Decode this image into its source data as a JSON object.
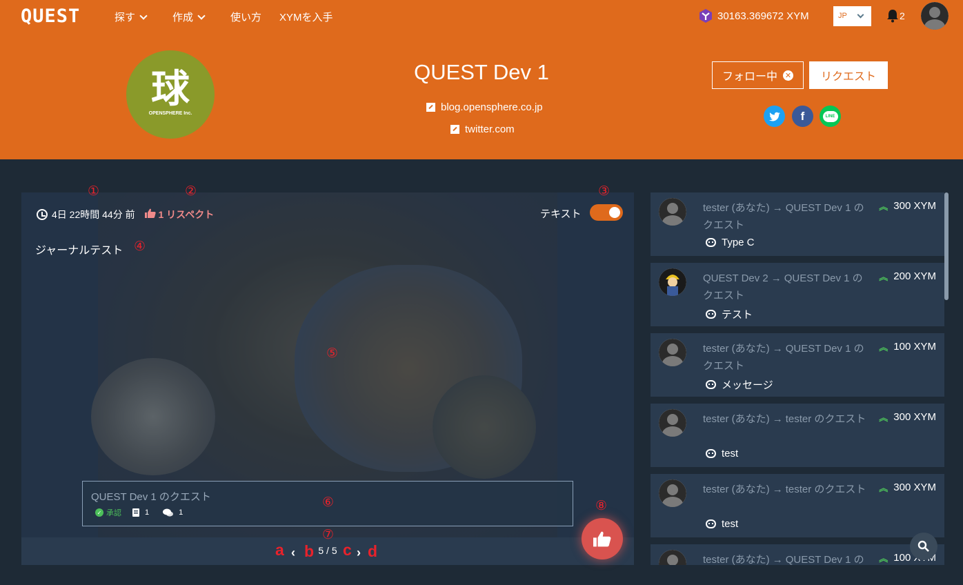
{
  "nav": {
    "logo": "QUEST",
    "items": [
      "探す",
      "作成",
      "使い方",
      "XYMを入手"
    ],
    "balance": "30163.369672 XYM",
    "language": "JP",
    "notification_count": "2",
    "accent_color": "#df6a1c"
  },
  "profile": {
    "logo_kanji": "球",
    "logo_caption": "OPENSPHERE Inc.",
    "name": "QUEST Dev 1",
    "links": [
      "blog.opensphere.co.jp",
      "twitter.com"
    ],
    "follow_label": "フォロー中",
    "request_label": "リクエスト",
    "social": [
      "twitter-icon",
      "facebook-icon",
      "line-icon"
    ],
    "line_label": "LINE"
  },
  "post": {
    "time_ago": "4日 22時間 44分 前",
    "respect": "1 リスペクト",
    "toggle_label": "テキスト",
    "toggle_on": true,
    "title": "ジャーナルテスト",
    "quest_card": {
      "title": "QUEST Dev 1 のクエスト",
      "status": "承認",
      "docs": "1",
      "comments": "1"
    },
    "pager": "5 / 5"
  },
  "annotations": {
    "numbers": [
      "①",
      "②",
      "③",
      "④",
      "⑤",
      "⑥",
      "⑦",
      "⑧"
    ],
    "letters": [
      "a",
      "b",
      "c",
      "d"
    ],
    "color": "#e8222b"
  },
  "feed": [
    {
      "from": "tester (あなた)",
      "to": "QUEST Dev 1 の クエスト",
      "amount": "300 XYM",
      "message": "Type C"
    },
    {
      "from": "QUEST Dev 2",
      "to": "QUEST Dev 1 の クエスト",
      "amount": "200 XYM",
      "message": "テスト"
    },
    {
      "from": "tester (あなた)",
      "to": "QUEST Dev 1 の クエスト",
      "amount": "100 XYM",
      "message": "メッセージ"
    },
    {
      "from": "tester (あなた)",
      "to": "tester のクエスト",
      "amount": "300 XYM",
      "message": "test"
    },
    {
      "from": "tester (あなた)",
      "to": "tester のクエスト",
      "amount": "300 XYM",
      "message": "test"
    },
    {
      "from": "tester (あなた)",
      "to": "QUEST Dev 1 の",
      "amount": "100 XYM",
      "message": ""
    }
  ]
}
